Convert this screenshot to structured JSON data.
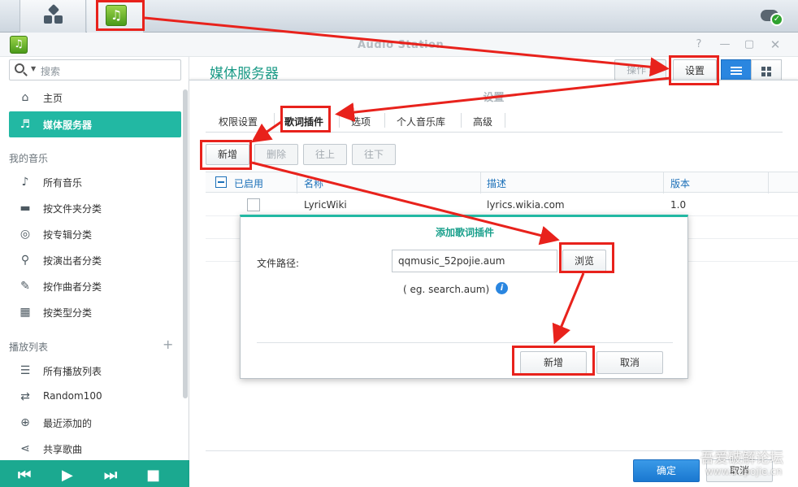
{
  "window": {
    "title": "Audio Station"
  },
  "search": {
    "placeholder": "搜索"
  },
  "sidebar": {
    "items_top": [
      {
        "label": "主页",
        "icon": "home-icon"
      },
      {
        "label": "媒体服务器",
        "icon": "media-server-icon",
        "active": true
      }
    ],
    "section_music": "我的音乐",
    "items_music": [
      {
        "label": "所有音乐",
        "icon": "music-note-icon"
      },
      {
        "label": "按文件夹分类",
        "icon": "folder-icon"
      },
      {
        "label": "按专辑分类",
        "icon": "album-icon"
      },
      {
        "label": "按演出者分类",
        "icon": "microphone-icon"
      },
      {
        "label": "按作曲者分类",
        "icon": "composer-icon"
      },
      {
        "label": "按类型分类",
        "icon": "genre-icon"
      }
    ],
    "section_playlist": "播放列表",
    "items_playlist": [
      {
        "label": "所有播放列表",
        "icon": "playlist-icon"
      },
      {
        "label": "Random100",
        "icon": "shuffle-icon"
      },
      {
        "label": "最近添加的",
        "icon": "add-circle-icon"
      },
      {
        "label": "共享歌曲",
        "icon": "share-icon"
      }
    ]
  },
  "header": {
    "title": "媒体服务器",
    "action_label": "操作 ▾",
    "settings_label": "设置"
  },
  "settings_dialog": {
    "title": "设置",
    "tabs": [
      "权限设置",
      "歌词插件",
      "选项",
      "个人音乐库",
      "高级"
    ],
    "active_tab": "歌词插件",
    "toolbar": {
      "add": "新增",
      "delete": "删除",
      "up": "往上",
      "down": "往下"
    },
    "columns": {
      "enabled": "已启用",
      "name": "名称",
      "description": "描述",
      "version": "版本"
    },
    "rows": [
      {
        "name": "LyricWiki",
        "description": "lyrics.wikia.com",
        "version": "1.0"
      }
    ],
    "ok": "确定",
    "cancel": "取消"
  },
  "add_plugin_dialog": {
    "title": "添加歌词插件",
    "file_path_label": "文件路径:",
    "file_path_value": "qqmusic_52pojie.aum",
    "browse": "浏览",
    "hint": "( eg. search.aum)",
    "add": "新增",
    "cancel": "取消"
  },
  "watermark": {
    "line1": "吾爱破解论坛",
    "line2": "www.52pojie.cn"
  },
  "colors": {
    "accent": "#22b8a3",
    "annotation": "#e8221c",
    "primary_button": "#1a78d0"
  }
}
